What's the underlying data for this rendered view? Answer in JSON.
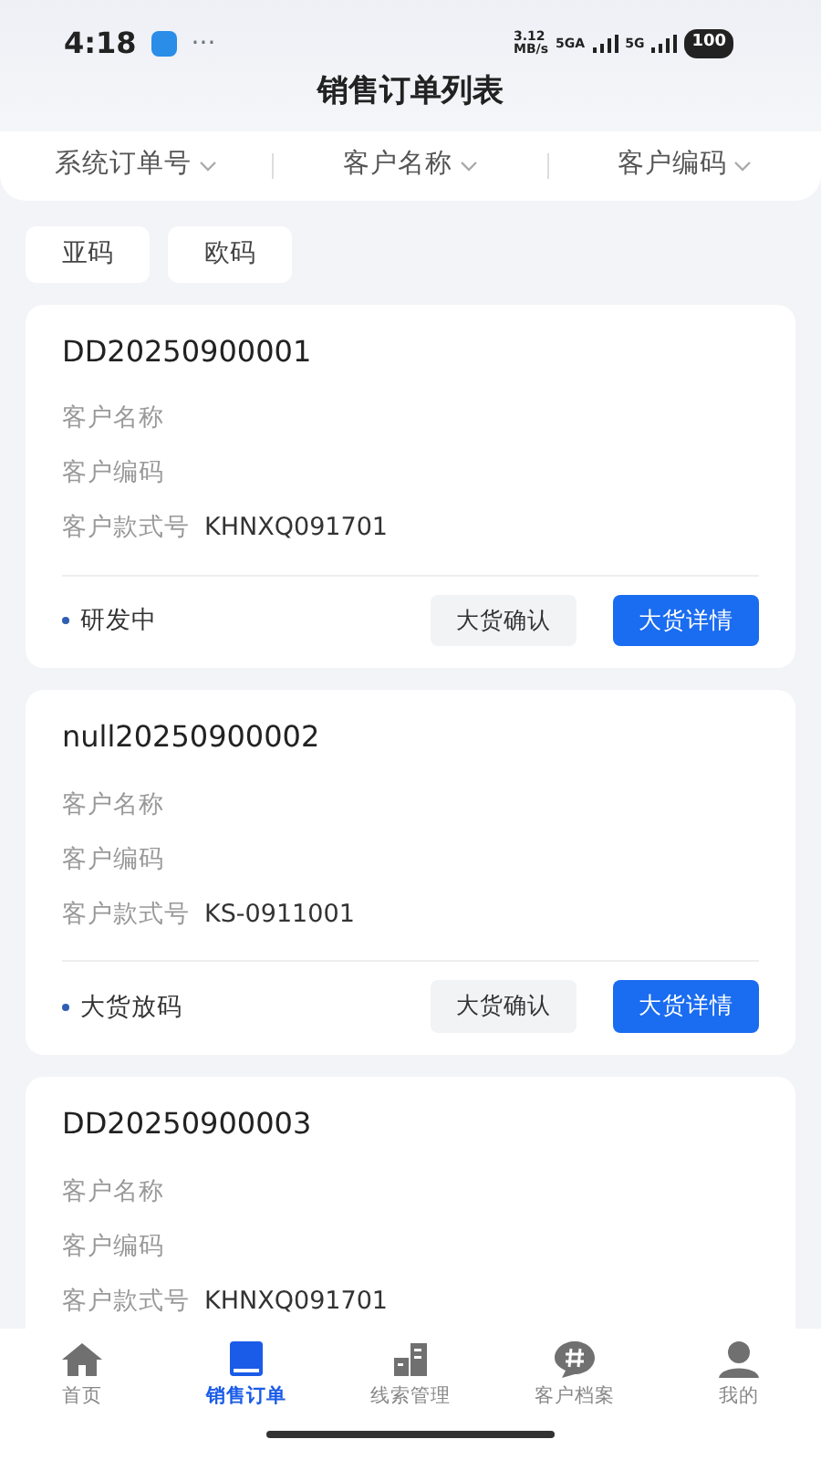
{
  "status_bar": {
    "time": "4:18",
    "more": "···",
    "speed_value": "3.12",
    "speed_unit": "MB/s",
    "network_1": "5GA",
    "network_2": "5G",
    "battery": "100"
  },
  "title": "销售订单列表",
  "filters": [
    {
      "label": "系统订单号"
    },
    {
      "label": "客户名称"
    },
    {
      "label": "客户编码"
    }
  ],
  "chips": [
    {
      "label": "亚码"
    },
    {
      "label": "欧码"
    }
  ],
  "orders": [
    {
      "order_no": "DD20250900001",
      "customer_name_label": "客户名称",
      "customer_code_label": "客户编码",
      "style_label": "客户款式号",
      "style_no": "KHNXQ091701",
      "status": "研发中",
      "color": "#2f5fb3",
      "confirm_button": "大货确认",
      "detail_button": "大货详情"
    },
    {
      "order_no": "null20250900002",
      "customer_name_label": "客户名称",
      "customer_code_label": "客户编码",
      "style_label": "客户款式号",
      "style_no": "KS-0911001",
      "status": "大货放码",
      "color": "#2f5fb3",
      "confirm_button": "大货确认",
      "detail_button": "大货详情"
    },
    {
      "order_no": "DD20250900003",
      "customer_name_label": "客户名称",
      "customer_code_label": "客户编码",
      "style_label": "客户款式号",
      "style_no": "KHNXQ091701"
    }
  ],
  "tab_bar": [
    {
      "label": "首页",
      "selected": false
    },
    {
      "label": "销售订单",
      "selected": true
    },
    {
      "label": "线索管理",
      "selected": false
    },
    {
      "label": "客户档案",
      "selected": false
    },
    {
      "label": "我的",
      "selected": false
    }
  ]
}
